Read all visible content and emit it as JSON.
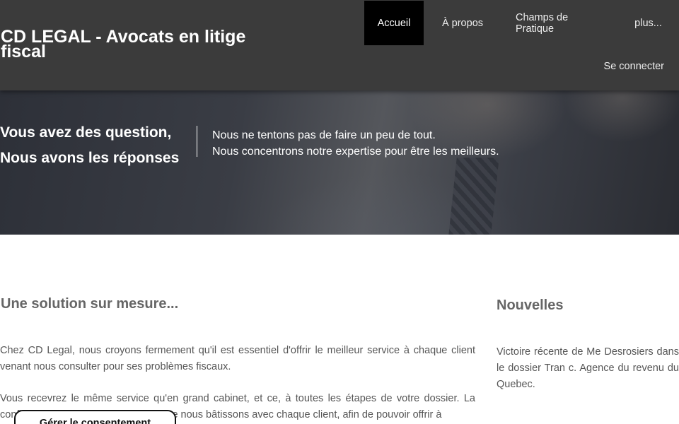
{
  "header": {
    "site_title": "CD LEGAL - Avocats en litige fiscal",
    "nav": [
      {
        "label": "Accueil",
        "active": true
      },
      {
        "label": "À propos"
      },
      {
        "label": "Champs de Pratique"
      },
      {
        "label": "plus..."
      }
    ],
    "login_label": "Se connecter"
  },
  "hero": {
    "heading_line1": "Vous avez des question,",
    "heading_line2": "Nous avons les réponses",
    "text_line1": "Nous ne tentons pas de faire un peu de tout.",
    "text_line2": "Nous concentrons notre expertise pour être les meilleurs."
  },
  "main": {
    "title": "Une solution sur mesure...",
    "paragraph1": "Chez CD Legal, nous croyons fermement qu'il est essentiel d'offrir le meilleur service à chaque client venant nous consulter pour ses problèmes fiscaux.",
    "paragraph2": "Vous recevrez le même service qu'en grand cabinet, et ce, à toutes les étapes de votre dossier. La confiance est la base de la relation que nous bâtissons avec chaque client, afin de pouvoir offrir à"
  },
  "news": {
    "title": "Nouvelles",
    "item1": "Victoire récente de Me Desrosiers dans le dossier Tran c. Agence du revenu du Quebec."
  },
  "consent": {
    "label": "Gérer le consentement"
  },
  "colors": {
    "header_bg": "#3b3b3b",
    "active_nav_bg": "#000000",
    "text_heading": "#666666"
  }
}
